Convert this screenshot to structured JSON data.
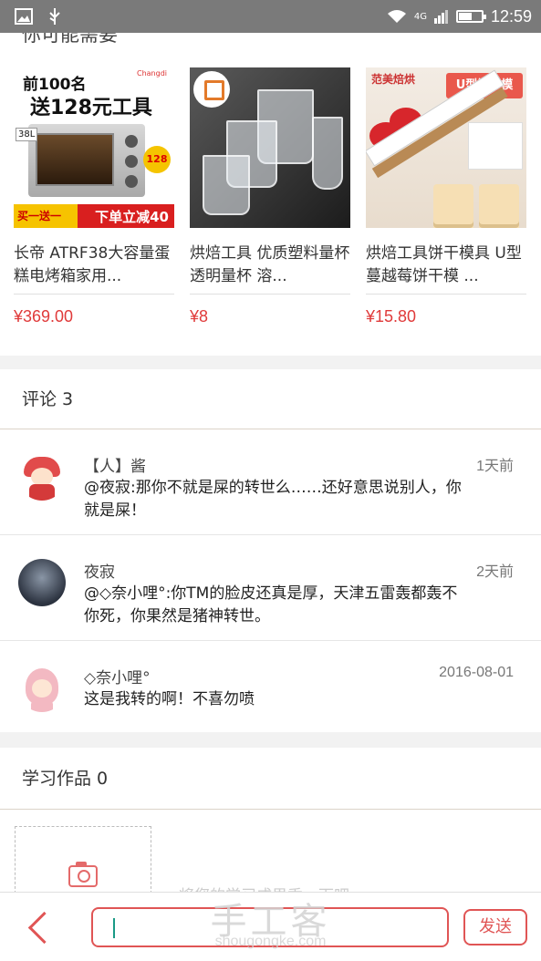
{
  "status_bar": {
    "network": "4G",
    "time": "12:59",
    "battery_level": 0.55,
    "icons": [
      "image-icon",
      "usb-icon",
      "wifi-icon",
      "signal-icon",
      "battery-icon"
    ]
  },
  "recommendations": {
    "title": "你可能需要",
    "items": [
      {
        "name": "长帝 ATRF38大容量蛋糕电烤箱家用...",
        "price": "¥369.00",
        "image_text": {
          "line1": "前100名",
          "line2": "送128元工具",
          "size": "38L",
          "badge": "128",
          "tag_left": "买一送一",
          "tag_right": "下单立减40",
          "brand": "Changdi"
        }
      },
      {
        "name": "烘焙工具 优质塑料量杯 透明量杯 溶...",
        "price": "¥8"
      },
      {
        "name": "烘焙工具饼干模具 U型蔓越莓饼干模 ...",
        "price": "¥15.80",
        "image_text": {
          "banner": "U型饼干模",
          "brand": "范美焙烘"
        }
      }
    ]
  },
  "comments": {
    "title": "评论 3",
    "items": [
      {
        "user": "【人】酱",
        "time": "1天前",
        "text": "@夜寂:那你不就是屎的转世么……还好意思说别人，你就是屎！"
      },
      {
        "user": "夜寂",
        "time": "2天前",
        "text": "@◇奈小哩°:你TM的脸皮还真是厚，天津五雷轰都轰不你死，你果然是猪神转世。"
      },
      {
        "user": "◇奈小哩°",
        "time": "2016-08-01",
        "text": "这是我转的啊！不喜勿喷"
      }
    ]
  },
  "works": {
    "title": "学习作品 0",
    "upload_hint": "将您的学习成果秀一下吧"
  },
  "bottom_bar": {
    "input_value": "",
    "send_label": "发送"
  },
  "watermark": {
    "brand": "手工客",
    "url": "shougongke.com"
  },
  "colors": {
    "accent": "#e05555",
    "price": "#e03a3a",
    "status_bar": "#7a7a7a"
  }
}
